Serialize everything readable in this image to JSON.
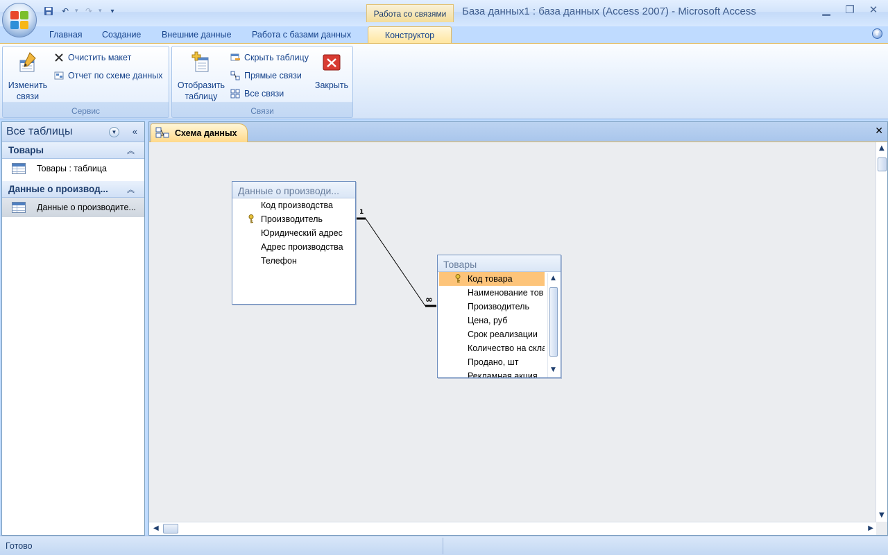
{
  "window": {
    "title": "База данных1 : база данных (Access 2007) - Microsoft Access",
    "context_tab_header": "Работа со связями"
  },
  "ribbon_tabs": [
    {
      "label": "Главная"
    },
    {
      "label": "Создание"
    },
    {
      "label": "Внешние данные"
    },
    {
      "label": "Работа с базами данных"
    },
    {
      "label": "Конструктор",
      "active": true
    }
  ],
  "ribbon": {
    "service_group": {
      "label": "Сервис",
      "edit_relations": "Изменить\nсвязи",
      "clear_layout": "Очистить макет",
      "relations_report": "Отчет по схеме данных"
    },
    "relations_group": {
      "label": "Связи",
      "show_table": "Отобразить\nтаблицу",
      "hide_table": "Скрыть таблицу",
      "direct_relations": "Прямые связи",
      "all_relations": "Все связи",
      "close": "Закрыть"
    }
  },
  "nav_pane": {
    "header": "Все таблицы",
    "groups": [
      {
        "title": "Товары",
        "items": [
          {
            "label": "Товары : таблица",
            "selected": false
          }
        ]
      },
      {
        "title": "Данные о производ...",
        "items": [
          {
            "label": "Данные о производите...",
            "selected": true
          }
        ]
      }
    ]
  },
  "document": {
    "tab_label": "Схема данных"
  },
  "relationship_tables": {
    "manufacturers": {
      "title": "Данные о производи...",
      "fields": [
        {
          "name": "Код производства",
          "key": false
        },
        {
          "name": "Производитель",
          "key": true
        },
        {
          "name": "Юридический адрес",
          "key": false
        },
        {
          "name": "Адрес производства",
          "key": false
        },
        {
          "name": "Телефон",
          "key": false
        }
      ]
    },
    "products": {
      "title": "Товары",
      "fields": [
        {
          "name": "Код товара",
          "key": true,
          "highlight": true
        },
        {
          "name": "Наименование тов",
          "key": false
        },
        {
          "name": "Производитель",
          "key": false
        },
        {
          "name": "Цена, руб",
          "key": false
        },
        {
          "name": "Срок реализации",
          "key": false
        },
        {
          "name": "Количество на скла",
          "key": false
        },
        {
          "name": "Продано, шт",
          "key": false
        },
        {
          "name": "Рекламная акция",
          "key": false
        }
      ]
    },
    "relation": {
      "one_label": "1",
      "many_label": "∞"
    }
  },
  "status": {
    "text": "Готово"
  },
  "colors": {
    "accent": "#15428b",
    "selected_field": "#fdc47a",
    "context_tab": "#f4dd9a"
  }
}
